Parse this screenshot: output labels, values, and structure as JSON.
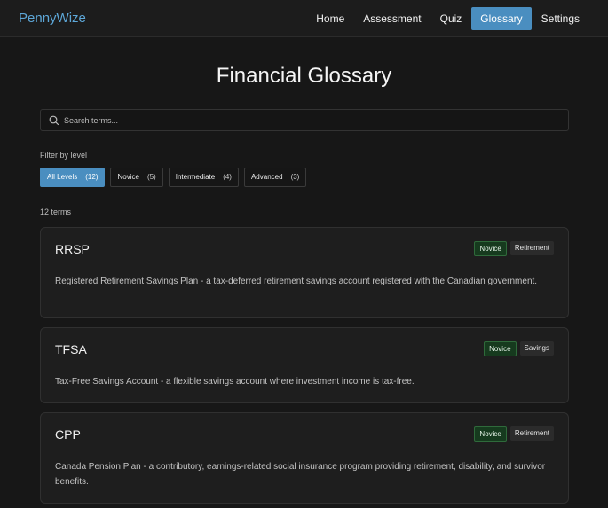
{
  "nav": {
    "brand": "PennyWize",
    "links": [
      {
        "label": "Home",
        "active": false
      },
      {
        "label": "Assessment",
        "active": false
      },
      {
        "label": "Quiz",
        "active": false
      },
      {
        "label": "Glossary",
        "active": true
      },
      {
        "label": "Settings",
        "active": false
      }
    ]
  },
  "page": {
    "title": "Financial Glossary"
  },
  "search": {
    "placeholder": "Search terms...",
    "value": "",
    "icon": "search-icon"
  },
  "filters": {
    "label": "Filter by level",
    "options": [
      {
        "label": "All Levels",
        "count": "(12)",
        "active": true
      },
      {
        "label": "Novice",
        "count": "(5)",
        "active": false
      },
      {
        "label": "Intermediate",
        "count": "(4)",
        "active": false
      },
      {
        "label": "Advanced",
        "count": "(3)",
        "active": false
      }
    ]
  },
  "results": {
    "count_text": "12 terms"
  },
  "terms": [
    {
      "term": "RRSP",
      "level": "Novice",
      "category": "Retirement",
      "definition": "Registered Retirement Savings Plan - a tax-deferred retirement savings account registered with the Canadian government."
    },
    {
      "term": "TFSA",
      "level": "Novice",
      "category": "Savings",
      "definition": "Tax-Free Savings Account - a flexible savings account where investment income is tax-free."
    },
    {
      "term": "CPP",
      "level": "Novice",
      "category": "Retirement",
      "definition": "Canada Pension Plan - a contributory, earnings-related social insurance program providing retirement, disability, and survivor benefits."
    }
  ],
  "colors": {
    "accent": "#4a8ec0",
    "brand": "#5da7d8",
    "background": "#171717",
    "card": "#1e1e1e",
    "level_tag": "#163a1e"
  }
}
